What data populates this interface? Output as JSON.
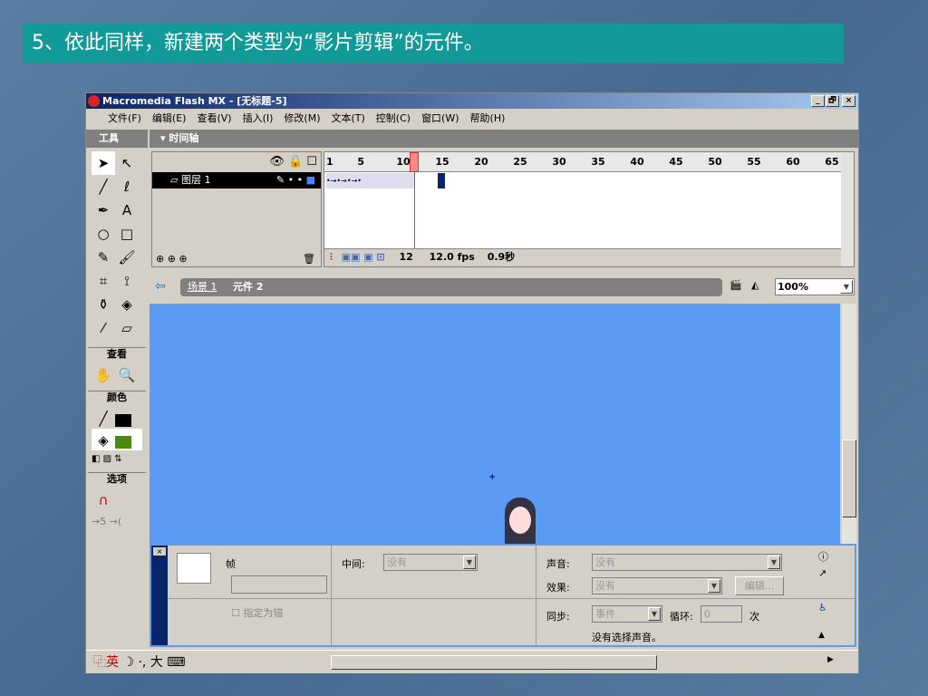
{
  "slide_title": "5、依此同样，新建两个类型为“影片剪辑”的元件。",
  "window": {
    "title": "Macromedia Flash MX - [无标题-5]",
    "controls": [
      "_",
      "🗗",
      "×"
    ]
  },
  "menu": [
    "文件(F)",
    "编辑(E)",
    "查看(V)",
    "插入(I)",
    "修改(M)",
    "文本(T)",
    "控制(C)",
    "窗口(W)",
    "帮助(H)"
  ],
  "tools": {
    "title": "工具",
    "view_label": "查看",
    "colors_label": "颜色",
    "options_label": "选项",
    "stroke_color": "#000000",
    "fill_color": "#4a8a10"
  },
  "timeline": {
    "title": "时间轴",
    "layer_name": "图层 1",
    "ruler": [
      "1",
      "5",
      "10",
      "15",
      "20",
      "25",
      "30",
      "35",
      "40",
      "45",
      "50",
      "55",
      "60",
      "65"
    ],
    "current_frame": "12",
    "fps": "12.0 fps",
    "time": "0.9秒",
    "playhead_frame": 12
  },
  "editbar": {
    "scene": "场景 1",
    "symbol": "元件 2",
    "zoom": "100%"
  },
  "props": {
    "frame_label": "帧",
    "anchor_label": "指定为锚",
    "tween_label": "中间:",
    "tween_value": "没有",
    "sound_label": "声音:",
    "sound_value": "没有",
    "effect_label": "效果:",
    "effect_value": "没有",
    "edit_button": "编辑...",
    "sync_label": "同步:",
    "sync_value": "事件",
    "loop_label": "循环:",
    "loop_value": "0",
    "times_label": "次",
    "no_sound": "没有选择声音。"
  },
  "taskbar": {
    "ime": "英"
  }
}
